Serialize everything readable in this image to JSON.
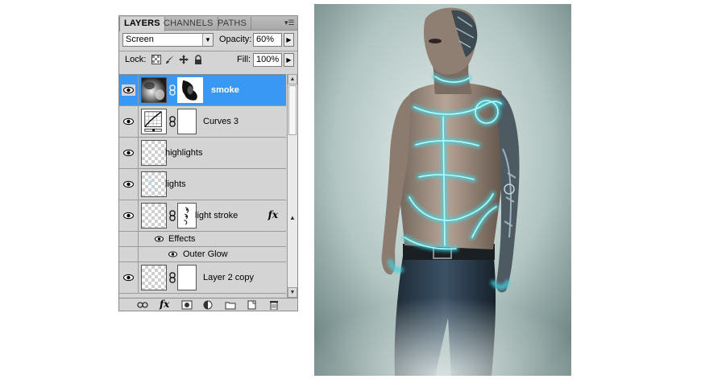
{
  "panel": {
    "tabs": [
      {
        "label": "LAYERS",
        "active": true
      },
      {
        "label": "CHANNELS",
        "active": false
      },
      {
        "label": "PATHS",
        "active": false
      }
    ],
    "menu_icon": "panel-menu-icon",
    "blend_mode": "Screen",
    "opacity_label": "Opacity:",
    "opacity_value": "60%",
    "lock_label": "Lock:",
    "fill_label": "Fill:",
    "fill_value": "100%"
  },
  "layers": [
    {
      "name": "smoke",
      "selected": true,
      "thumb": "smoke-texture",
      "has_mask": true
    },
    {
      "name": "Curves 3",
      "selected": false,
      "thumb": "curves-adjustment",
      "has_mask": true
    },
    {
      "name": "highlights",
      "selected": false,
      "thumb": "transparent",
      "has_mask": false
    },
    {
      "name": "lights",
      "selected": false,
      "thumb": "transparent",
      "has_mask": false
    },
    {
      "name": "light stroke",
      "selected": false,
      "thumb": "transparent",
      "has_mask": true,
      "fx": "fx"
    },
    {
      "name": "Layer 2 copy",
      "selected": false,
      "thumb": "transparent",
      "has_mask": true
    }
  ],
  "effects": {
    "label": "Effects",
    "items": [
      "Outer Glow"
    ]
  },
  "bottom_icons": [
    "link-layers-icon",
    "fx-icon",
    "add-mask-icon",
    "adjustment-layer-icon",
    "new-group-icon",
    "new-layer-icon",
    "trash-icon"
  ],
  "colors": {
    "selection": "#3a98f5",
    "panel_bg": "#d4d4d4",
    "glow": "#3fd4e0"
  },
  "artwork": {
    "subject": "cyborg-man-with-glowing-cyan-circuit-lines"
  }
}
